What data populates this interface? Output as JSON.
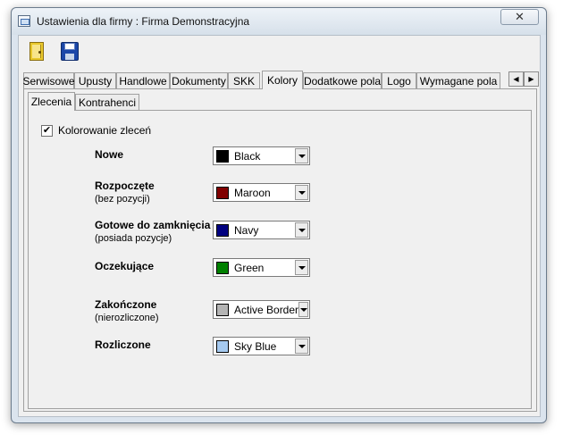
{
  "window": {
    "title": "Ustawienia dla firmy  : Firma Demonstracyjna",
    "close_label": "✕"
  },
  "toolbar": {
    "exit_icon": "door-exit-icon",
    "save_icon": "floppy-save-icon"
  },
  "tabs": [
    {
      "label": "Serwisowe"
    },
    {
      "label": "Upusty"
    },
    {
      "label": "Handlowe"
    },
    {
      "label": "Dokumenty"
    },
    {
      "label": "SKK"
    },
    {
      "label": "Kolory",
      "active": true
    },
    {
      "label": "Dodatkowe pola"
    },
    {
      "label": "Logo"
    },
    {
      "label": "Wymagane pola"
    }
  ],
  "tab_scroll": {
    "left": "◀",
    "right": "▶"
  },
  "subtabs": [
    {
      "label": "Zlecenia",
      "active": true
    },
    {
      "label": "Kontrahenci"
    }
  ],
  "coloring": {
    "checkbox_label": "Kolorowanie zleceń",
    "checked": true,
    "check_mark": "✔"
  },
  "color_rows": [
    {
      "label": "Nowe",
      "sub": "",
      "value": "Black",
      "color": "#000000"
    },
    {
      "label": "Rozpoczęte",
      "sub": "(bez pozycji)",
      "value": "Maroon",
      "color": "#800000"
    },
    {
      "label": "Gotowe do zamknięcia",
      "sub": "(posiada pozycje)",
      "value": "Navy",
      "color": "#000080"
    },
    {
      "label": "Oczekujące",
      "sub": "",
      "value": "Green",
      "color": "#008000"
    },
    {
      "label": "Zakończone",
      "sub": "(nierozliczone)",
      "value": "Active Border",
      "color": "#b4b4b4"
    },
    {
      "label": "Rozliczone",
      "sub": "",
      "value": "Sky Blue",
      "color": "#a6caf0"
    }
  ]
}
